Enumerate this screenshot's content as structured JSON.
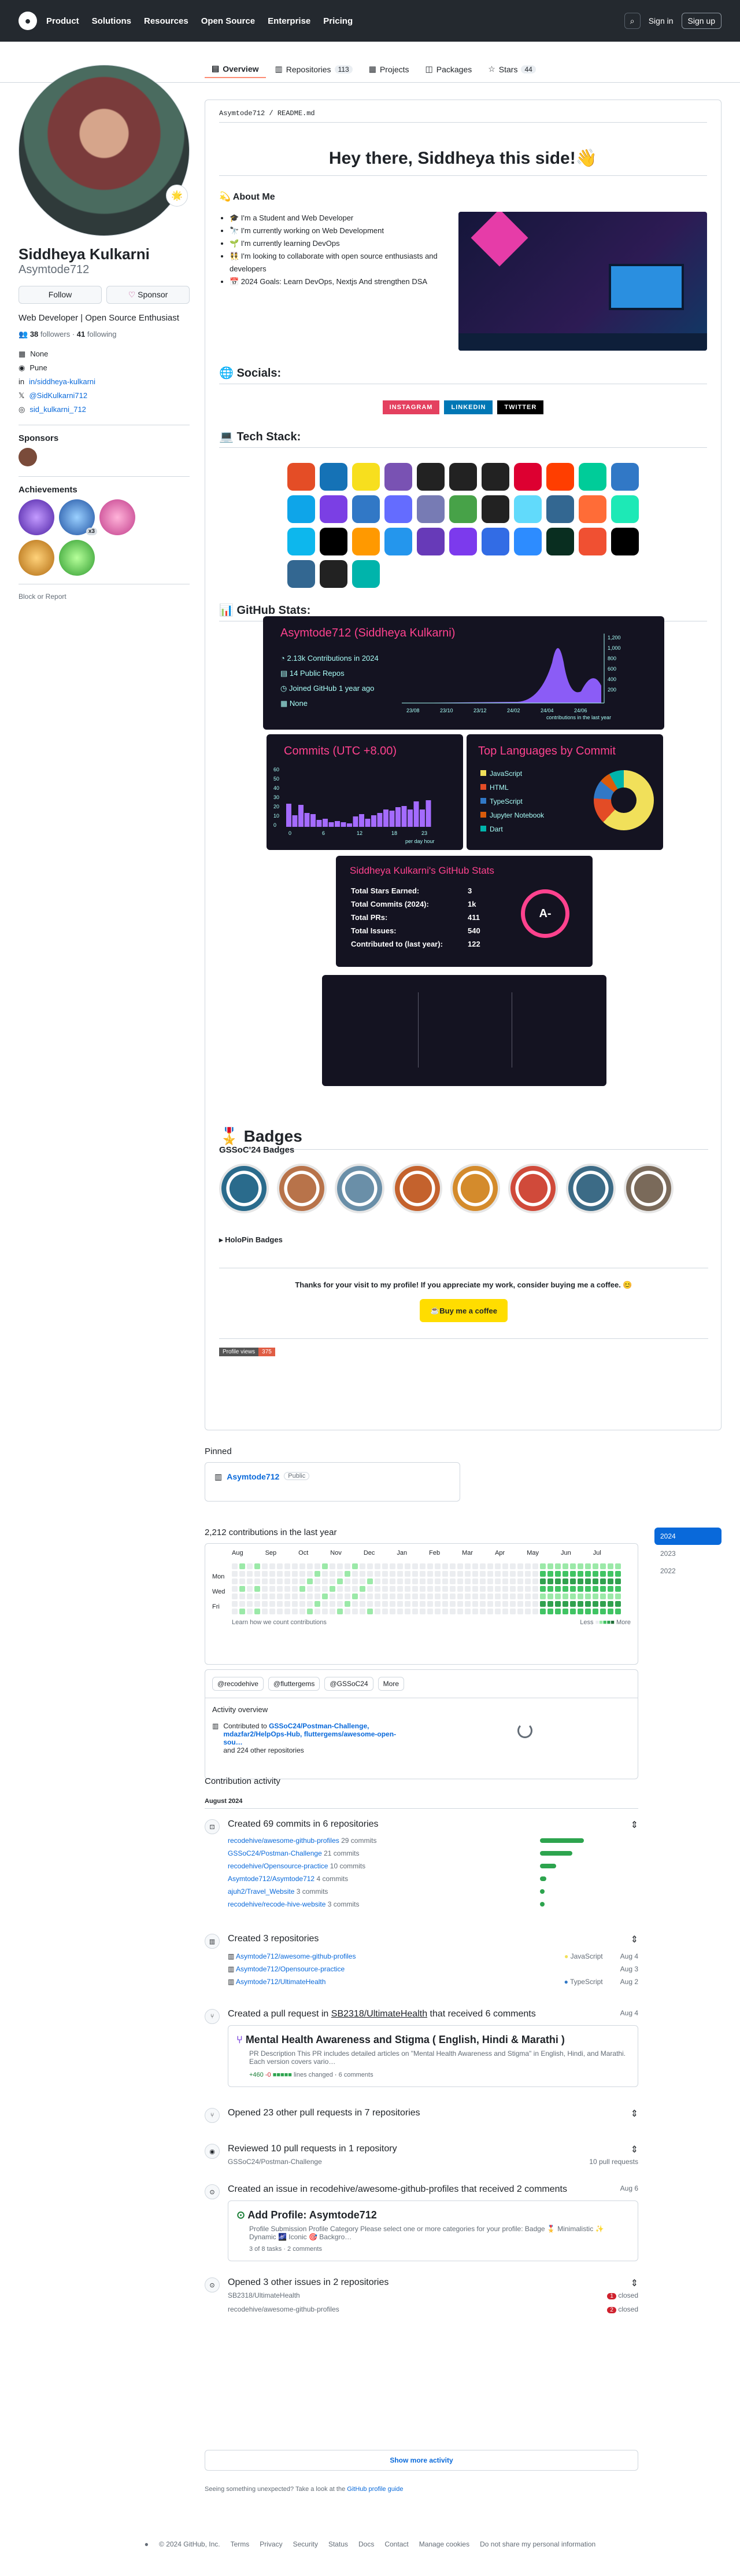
{
  "nav": {
    "items": [
      "Product",
      "Solutions",
      "Resources",
      "Open Source",
      "Enterprise",
      "Pricing"
    ],
    "signin": "Sign in",
    "signup": "Sign up"
  },
  "tabs": {
    "overview": "Overview",
    "repos": "Repositories",
    "repos_count": "113",
    "projects": "Projects",
    "packages": "Packages",
    "stars": "Stars",
    "stars_count": "44"
  },
  "profile": {
    "name": "Siddheya Kulkarni",
    "login": "Asymtode712",
    "follow": "Follow",
    "sponsor": "Sponsor",
    "bio": "Web Developer | Open Source Enthusiast",
    "followers": "38",
    "followers_label": "followers",
    "following": "41",
    "following_label": "following",
    "company": "None",
    "location": "Pune",
    "linkedin": "in/siddheya-kulkarni",
    "twitter": "@SidKulkarni712",
    "instagram": "sid_kulkarni_712",
    "sponsors_title": "Sponsors",
    "achievements_title": "Achievements",
    "block": "Block or Report",
    "ach_count": "x3"
  },
  "readme": {
    "path": "Asymtode712 / README.md",
    "title": "Hey there, Siddheya this side!👋",
    "about_title": "💫 About Me",
    "about": [
      "🎓 I'm a Student and Web Developer",
      "🔭 I'm currently working on Web Development",
      "🌱 I'm currently learning DevOps",
      "👯 I'm looking to collaborate with open source enthusiasts and developers",
      "📅 2024 Goals: Learn DevOps, Nextjs And strengthen DSA"
    ],
    "socials_title": "🌐 Socials:",
    "socials": [
      "INSTAGRAM",
      "LINKEDIN",
      "TWITTER"
    ],
    "tech_title": "💻 Tech Stack:",
    "stats_title": "📊 GitHub Stats:",
    "badges_title": "🎖️ Badges",
    "gssoc_title": "GSSoC'24 Badges",
    "holopin": "▸ HoloPin Badges",
    "thanks": "Thanks for your visit to my profile! If you appreciate my work, consider buying me a coffee. 😊",
    "coffee": "Buy me a coffee",
    "views_label": "Profile views",
    "views": "375"
  },
  "stats_card": {
    "title": "Asymtode712 (Siddheya Kulkarni)",
    "l1": "2.13k Contributions in 2024",
    "l2": "14 Public Repos",
    "l3": "Joined GitHub 1 year ago",
    "l4": "None",
    "xticks": [
      "23/08",
      "23/10",
      "23/12",
      "24/02",
      "24/04",
      "24/06"
    ],
    "yticks": [
      "1,200",
      "1,000",
      "800",
      "600",
      "400",
      "200"
    ],
    "caption": "contributions in the last year"
  },
  "commits_card": {
    "title": "Commits (UTC +8.00)",
    "caption": "per day hour",
    "yticks": [
      "60",
      "50",
      "40",
      "30",
      "20",
      "10",
      "0"
    ],
    "xticks": [
      "0",
      "6",
      "12",
      "18",
      "23"
    ]
  },
  "lang_card": {
    "title": "Top Languages by Commit",
    "langs": [
      {
        "n": "JavaScript",
        "c": "#f1e05a"
      },
      {
        "n": "HTML",
        "c": "#e34c26"
      },
      {
        "n": "TypeScript",
        "c": "#3178c6"
      },
      {
        "n": "Jupyter Notebook",
        "c": "#da5b0b"
      },
      {
        "n": "Dart",
        "c": "#00b4ab"
      }
    ]
  },
  "gh_stats": {
    "title": "Siddheya Kulkarni's GitHub Stats",
    "rows": [
      [
        "Total Stars Earned:",
        "3"
      ],
      [
        "Total Commits (2024):",
        "1k"
      ],
      [
        "Total PRs:",
        "411"
      ],
      [
        "Total Issues:",
        "540"
      ],
      [
        "Contributed to (last year):",
        "122"
      ]
    ],
    "grade": "A-"
  },
  "pinned": {
    "title": "Pinned",
    "repo": "Asymtode712",
    "vis": "Public"
  },
  "contrib": {
    "title": "2,212 contributions in the last year",
    "months": [
      "Aug",
      "Sep",
      "Oct",
      "Nov",
      "Dec",
      "Jan",
      "Feb",
      "Mar",
      "Apr",
      "May",
      "Jun",
      "Jul"
    ],
    "days": [
      "Mon",
      "Wed",
      "Fri"
    ],
    "learn": "Learn how we count contributions",
    "less": "Less",
    "more": "More",
    "years": [
      "2024",
      "2023",
      "2022"
    ],
    "orgs": [
      "@recodehive",
      "@fluttergems",
      "@GSSoC24"
    ],
    "more_btn": "More",
    "overview": "Activity overview",
    "contributed": "Contributed to",
    "repos": "GSSoC24/Postman-Challenge, mdazfar2/HelpOps-Hub, fluttergems/awesome-open-sou…",
    "others": "and 224 other repositories"
  },
  "activity": {
    "title": "Contribution activity",
    "month": "August 2024",
    "commits_head": "Created 69 commits in 6 repositories",
    "commit_rows": [
      [
        "recodehive/awesome-github-profiles",
        "29 commits",
        0.95
      ],
      [
        "GSSoC24/Postman-Challenge",
        "21 commits",
        0.7
      ],
      [
        "recodehive/Opensource-practice",
        "10 commits",
        0.35
      ],
      [
        "Asymtode712/Asymtode712",
        "4 commits",
        0.14
      ],
      [
        "ajuh2/Travel_Website",
        "3 commits",
        0.1
      ],
      [
        "recodehive/recode-hive-website",
        "3 commits",
        0.1
      ]
    ],
    "repos_head": "Created 3 repositories",
    "repo_rows": [
      [
        "Asymtode712/awesome-github-profiles",
        "JavaScript",
        "#f1e05a",
        "Aug 4"
      ],
      [
        "Asymtode712/Opensource-practice",
        "",
        "",
        "Aug 3"
      ],
      [
        "Asymtode712/UltimateHealth",
        "TypeScript",
        "#3178c6",
        "Aug 2"
      ]
    ],
    "pr_head_pre": "Created a pull request in",
    "pr_head_repo": "SB2318/UltimateHealth",
    "pr_head_post": "that received 6 comments",
    "pr_date": "Aug 4",
    "pr_title": "Mental Health Awareness and Stigma ( English, Hindi & Marathi )",
    "pr_body": "PR Description This PR includes detailed articles on \"Mental Health Awareness and Stigma\" in English, Hindi, and Marathi. Each version covers vario…",
    "pr_add": "+460",
    "pr_del": "-0",
    "pr_lines": "lines changed",
    "pr_comments": "6 comments",
    "opened_head": "Opened 23 other pull requests in 7 repositories",
    "reviewed_head": "Reviewed 10 pull requests in 1 repository",
    "reviewed_repo": "GSSoC24/Postman-Challenge",
    "reviewed_count": "10 pull requests",
    "issue_head": "Created an issue in recodehive/awesome-github-profiles that received 2 comments",
    "issue_date": "Aug 6",
    "issue_title": "Add Profile: Asymtode712",
    "issue_body": "Profile Submission Profile Category Please select one or more categories for your profile: Badge 🎖️ Minimalistic ✨ Dynamic 🌌 Iconic 🎯 Backgro…",
    "issue_tasks": "3 of 8 tasks",
    "issue_comments": "2 comments",
    "other_head": "Opened 3 other issues in 2 repositories",
    "other_rows": [
      [
        "SB2318/UltimateHealth",
        "1",
        "closed"
      ],
      [
        "recodehive/awesome-github-profiles",
        "2",
        "closed"
      ]
    ],
    "show_more": "Show more activity",
    "unexpected": "Seeing something unexpected? Take a look at the",
    "guide": "GitHub profile guide"
  },
  "footer": [
    "© 2024 GitHub, Inc.",
    "Terms",
    "Privacy",
    "Security",
    "Status",
    "Docs",
    "Contact",
    "Manage cookies",
    "Do not share my personal information"
  ]
}
